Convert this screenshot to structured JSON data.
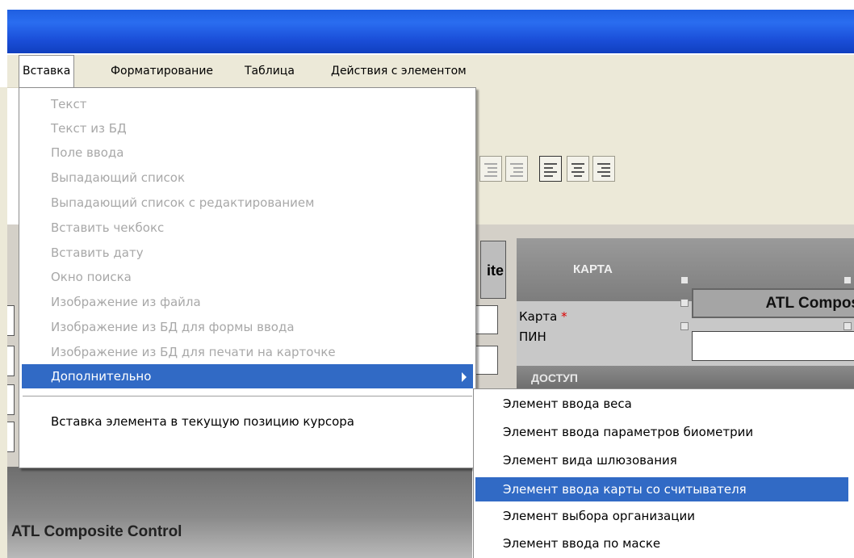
{
  "menubar": {
    "items": [
      {
        "label": "Вставка"
      },
      {
        "label": "Форматирование"
      },
      {
        "label": "Таблица"
      },
      {
        "label": "Действия с элементом"
      }
    ]
  },
  "insert_menu": {
    "items": [
      {
        "label": "Текст",
        "enabled": false
      },
      {
        "label": "Текст из БД",
        "enabled": false
      },
      {
        "label": "Поле ввода",
        "enabled": false
      },
      {
        "label": "Выпадающий список",
        "enabled": false
      },
      {
        "label": "Выпадающий список с редактированием",
        "enabled": false
      },
      {
        "label": "Вставить чекбокс",
        "enabled": false
      },
      {
        "label": "Вставить дату",
        "enabled": false
      },
      {
        "label": "Окно поиска",
        "enabled": false
      },
      {
        "label": "Изображение из файла",
        "enabled": false
      },
      {
        "label": "Изображение из БД для формы ввода",
        "enabled": false
      },
      {
        "label": "Изображение из БД для печати на карточке",
        "enabled": false
      },
      {
        "label": "Дополнительно",
        "enabled": true,
        "highlighted": true,
        "submenu": true
      },
      {
        "label": "Вставка элемента в текущую позицию курсора",
        "enabled": true
      }
    ]
  },
  "additional_submenu": {
    "items": [
      {
        "label": "Элемент ввода веса"
      },
      {
        "label": "Элемент ввода параметров биометрии"
      },
      {
        "label": "Элемент вида шлюзования"
      },
      {
        "label": "Элемент ввода карты со считывателя",
        "highlighted": true
      },
      {
        "label": "Элемент выбора организации"
      },
      {
        "label": "Элемент ввода по маске"
      }
    ]
  },
  "form": {
    "ite_fragment": "ite",
    "karta_header": "КАРТА",
    "karta_label": "Карта",
    "required_mark": "*",
    "pin_label": "ПИН",
    "atl_box_text": "ATL Compos",
    "dostup_header": "ДОСТУП",
    "control_label": "ATL Composite Control"
  },
  "colors": {
    "highlight": "#316ac5",
    "titlebar": "#2a6df0",
    "menubar": "#ece9d8",
    "disabled_text": "#a8a8a8"
  }
}
